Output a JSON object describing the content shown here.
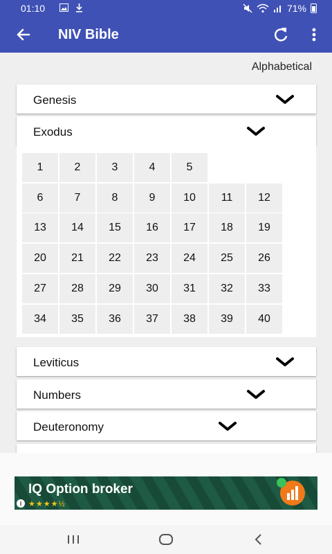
{
  "status": {
    "time": "01:10",
    "battery": "71%",
    "icons": [
      "image-icon",
      "download-icon",
      "mute-icon",
      "wifi-icon",
      "signal-icon",
      "battery-icon"
    ]
  },
  "app_bar": {
    "title": "NIV Bible",
    "icons": [
      "back-arrow-icon",
      "refresh-icon",
      "more-vert-icon"
    ],
    "color": "#3f51b5"
  },
  "sort_label": "Alphabetical",
  "books": [
    {
      "name": "Genesis",
      "expanded": false
    },
    {
      "name": "Exodus",
      "expanded": true
    },
    {
      "name": "Leviticus",
      "expanded": false
    },
    {
      "name": "Numbers",
      "expanded": false
    },
    {
      "name": "Deuteronomy",
      "expanded": false
    }
  ],
  "chapters": [
    "1",
    "2",
    "3",
    "4",
    "5",
    "6",
    "7",
    "8",
    "9",
    "10",
    "11",
    "12",
    "13",
    "14",
    "15",
    "16",
    "17",
    "18",
    "19",
    "20",
    "21",
    "22",
    "23",
    "24",
    "25",
    "26",
    "27",
    "28",
    "29",
    "30",
    "31",
    "32",
    "33",
    "34",
    "35",
    "36",
    "37",
    "38",
    "39",
    "40"
  ],
  "ad": {
    "title": "IQ Option broker",
    "stars": "★★★★½",
    "info_label": "i"
  },
  "nav": {
    "icons": [
      "recent-apps-icon",
      "home-icon",
      "back-icon"
    ]
  }
}
